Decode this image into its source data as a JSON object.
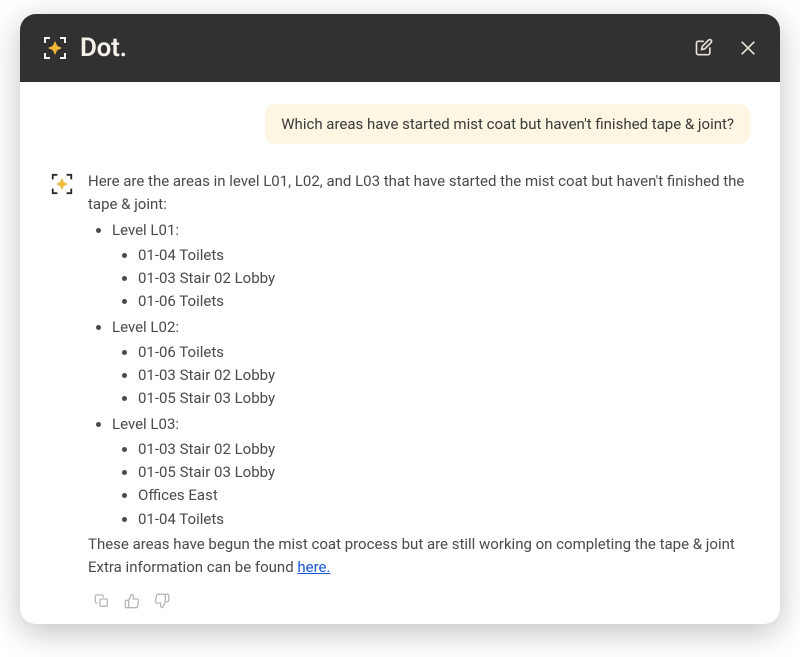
{
  "brand": {
    "name": "Dot."
  },
  "conversation": {
    "user_message": "Which areas have started mist coat but haven't finished tape & joint?",
    "assistant": {
      "intro": "Here are the areas in level L01, L02, and L03 that have started the mist coat but haven't finished the tape & joint:",
      "levels": [
        {
          "label": "Level L01:",
          "items": [
            "01-04 Toilets",
            "01-03 Stair 02 Lobby",
            "01-06 Toilets"
          ]
        },
        {
          "label": "Level L02:",
          "items": [
            "01-06 Toilets",
            "01-03 Stair 02 Lobby",
            "01-05 Stair 03 Lobby"
          ]
        },
        {
          "label": "Level L03:",
          "items": [
            "01-03 Stair 02 Lobby",
            "01-05 Stair 03 Lobby",
            "Offices East",
            "01-04 Toilets"
          ]
        }
      ],
      "closing": "These areas have begun the mist coat process but are still working on completing the tape & joint",
      "extra_prefix": "Extra information can be found ",
      "extra_link_text": "here."
    }
  }
}
